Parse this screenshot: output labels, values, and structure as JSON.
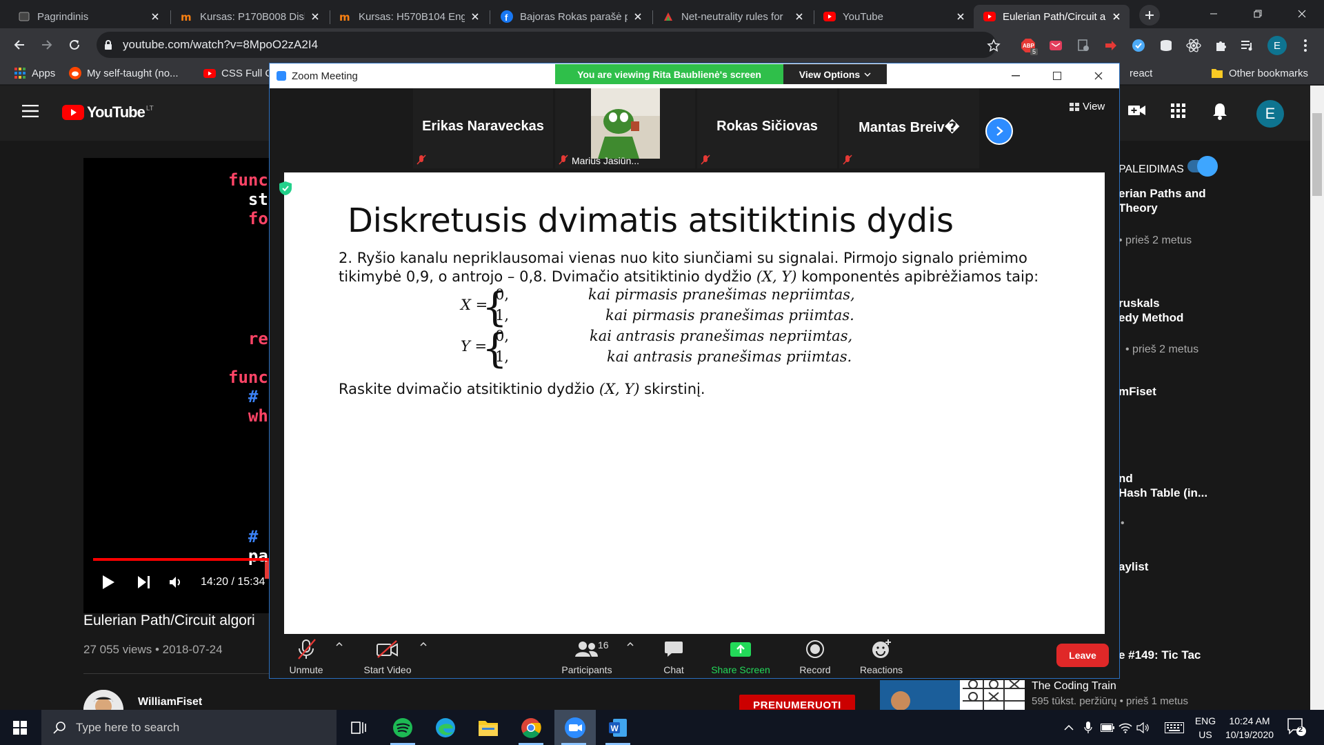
{
  "browser": {
    "tabs": [
      {
        "title": "Pagrindinis",
        "icon": "moodle-icon"
      },
      {
        "title": "Kursas: P170B008 Disk",
        "icon": "moodle-m-icon"
      },
      {
        "title": "Kursas: H570B104 Engl",
        "icon": "moodle-m-icon"
      },
      {
        "title": "Bajoras Rokas parašė p",
        "icon": "facebook-icon"
      },
      {
        "title": "Net-neutrality rules for",
        "icon": "news-icon"
      },
      {
        "title": "YouTube",
        "icon": "youtube-icon"
      },
      {
        "title": "Eulerian Path/Circuit al",
        "icon": "youtube-icon",
        "active": true
      }
    ],
    "url": "youtube.com/watch?v=8MpoO2zA2I4",
    "profile_initial": "E",
    "adblock_count": "5",
    "bookmarks": [
      {
        "label": "Apps",
        "icon": "apps-grid-icon"
      },
      {
        "label": "My self-taught (no...",
        "icon": "reddit-icon"
      },
      {
        "label": "CSS Full C",
        "icon": "youtube-icon"
      },
      {
        "label": "react",
        "icon": "folder-icon"
      },
      {
        "label": "Other bookmarks",
        "icon": "folder-icon"
      }
    ]
  },
  "youtube": {
    "logo_text": "YouTube",
    "region": "LT",
    "avatar_initial": "E",
    "code_lines": [
      {
        "text": "func",
        "color": "#ff4466"
      },
      {
        "text": "  st",
        "color": "#ffffff"
      },
      {
        "text": "  fo",
        "color": "#ff4466"
      },
      {
        "text": "  re",
        "color": "#ff4466"
      },
      {
        "text": "func",
        "color": "#ff4466"
      },
      {
        "text": "  #",
        "color": "#3b82f6"
      },
      {
        "text": "  wh",
        "color": "#ff4466"
      },
      {
        "text": "  #",
        "color": "#3b82f6"
      },
      {
        "text": "  pa",
        "color": "#ffffff"
      }
    ],
    "time": "14:20 / 15:34",
    "progress": 0.92,
    "video_title": "Eulerian Path/Circuit algori",
    "video_meta": "27 055 views • 2018-07-24",
    "channel": "WilliamFiset",
    "subscribe_label": "PRENUMERUOTI",
    "autoplay_label": "PALEIDIMAS",
    "sidebar": [
      {
        "line1": "erian Paths and",
        "line2": "Theory",
        "meta": "• prieš 2 metus"
      },
      {
        "line1": "ruskals",
        "line2": "edy Method",
        "meta": "• prieš 2 metus"
      },
      {
        "line1": "mFiset",
        "line2": "",
        "meta": ""
      },
      {
        "line1": "nd",
        "line2": "Hash Table (in...",
        "meta": "•"
      },
      {
        "line1": "aylist",
        "line2": "",
        "meta": ""
      },
      {
        "line1": "e #149: Tic Tac",
        "line2": "",
        "meta": ""
      }
    ],
    "bottom_sidebar": {
      "channel": "The Coding Train",
      "meta": "595 tūkst. peržiūrų • prieš 1 metus"
    }
  },
  "zoom": {
    "app_name": "Zoom Meeting",
    "share_banner": "You are viewing Rita Baublienė's screen",
    "view_options": "View Options",
    "view_label": "View",
    "participants": [
      {
        "name": "Erikas Naraveckas"
      },
      {
        "name": "Marius Jasiūn...",
        "video": true
      },
      {
        "name": "Rokas Sičiovas"
      },
      {
        "name": "Mantas Breiv�"
      }
    ],
    "slide": {
      "title": "Diskretusis dvimatis atsitiktinis dydis",
      "line1": "2. Ryšio kanalu nepriklausomai vienas nuo kito siunčiami su signalai. Pirmojo signalo priėmimo",
      "line2a": "tikimybė 0,9, o antrojo – 0,8. Dvimačio atsitiktinio dydžio ",
      "line2m": "(X, Y)",
      "line2b": " komponentės apibrėžiamos taip:",
      "x_def": {
        "var": "X =",
        "v0": "0,",
        "c0": "kai pirmasis pranešimas nepriimtas,",
        "v1": "1,",
        "c1": "kai pirmasis pranešimas priimtas."
      },
      "y_def": {
        "var": "Y =",
        "v0": "0,",
        "c0": "kai antrasis pranešimas nepriimtas,",
        "v1": "1,",
        "c1": "kai antrasis pranešimas priimtas."
      },
      "question_a": "Raskite dvimačio atsitiktinio dydžio ",
      "question_m": "(X, Y)",
      "question_b": " skirstinį."
    },
    "toolbar": {
      "unmute": "Unmute",
      "start_video": "Start Video",
      "participants": "Participants",
      "participants_count": "16",
      "chat": "Chat",
      "share_screen": "Share Screen",
      "record": "Record",
      "reactions": "Reactions",
      "leave": "Leave"
    }
  },
  "taskbar": {
    "search_placeholder": "Type here to search",
    "lang_top": "ENG",
    "lang_bottom": "US",
    "time": "10:24 AM",
    "date": "10/19/2020",
    "notifications": "2"
  }
}
